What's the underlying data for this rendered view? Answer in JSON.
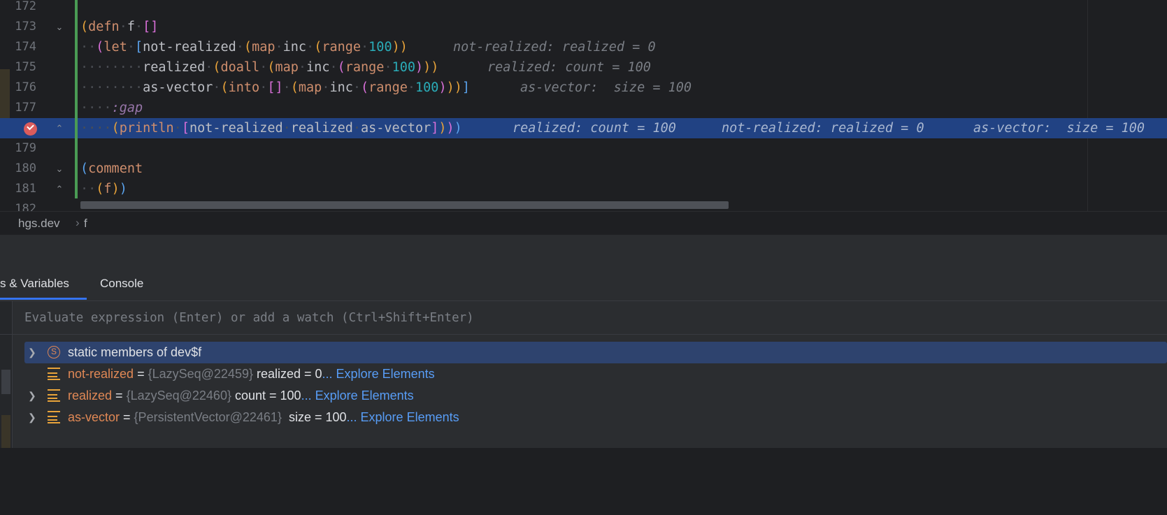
{
  "editor": {
    "lines": [
      {
        "n": "172"
      },
      {
        "n": "173"
      },
      {
        "n": "174",
        "inlay": "not-realized: realized = 0"
      },
      {
        "n": "175",
        "inlay": "realized: count = 100"
      },
      {
        "n": "176",
        "inlay": "as-vector:  size = 100"
      },
      {
        "n": "177"
      },
      {
        "n": "178",
        "inlays": [
          "realized: count = 100",
          "not-realized: realized = 0",
          "as-vector:  size = 100"
        ]
      },
      {
        "n": "179"
      },
      {
        "n": "180"
      },
      {
        "n": "181"
      },
      {
        "n": "182"
      }
    ],
    "code": {
      "l173": [
        "(",
        "defn",
        "f",
        "[",
        "]"
      ],
      "l174": [
        "(",
        "let",
        "[",
        "not-realized",
        "(",
        "map",
        "inc",
        "(",
        "range",
        "100",
        ")",
        ")"
      ],
      "l175": [
        "realized",
        "(",
        "doall",
        "(",
        "map",
        "inc",
        "(",
        "range",
        "100",
        ")",
        ")",
        ")"
      ],
      "l176": [
        "as-vector",
        "(",
        "into",
        "[",
        "]",
        "(",
        "map",
        "inc",
        "(",
        "range",
        "100",
        ")",
        ")",
        ")",
        "]"
      ],
      "l177": [
        ":gap"
      ],
      "l178": [
        "(",
        "println",
        "[",
        "not-realized",
        "realized",
        "as-vector",
        "]",
        ")",
        ")",
        ")"
      ],
      "l180": [
        "(",
        "comment"
      ],
      "l181": [
        "(",
        "f",
        ")",
        ")"
      ]
    }
  },
  "breadcrumb": {
    "namespace": "hgs.dev",
    "separator": "›",
    "function": "f"
  },
  "debug": {
    "tabs": {
      "variables": "s & Variables",
      "console": "Console"
    },
    "evaluate_placeholder": "Evaluate expression (Enter) or add a watch (Ctrl+Shift+Enter)",
    "rows": [
      {
        "label": "static members of dev$f",
        "icon_letter": "S"
      },
      {
        "name": "not-realized",
        "eq": " = ",
        "type": "{LazySeq@22459}",
        "value": " realized = 0",
        "link": "... Explore Elements"
      },
      {
        "name": "realized",
        "eq": " = ",
        "type": "{LazySeq@22460}",
        "value": " count = 100",
        "link": "... Explore Elements"
      },
      {
        "name": "as-vector",
        "eq": " = ",
        "type": "{PersistentVector@22461}",
        "value": "  size = 100",
        "link": "... Explore Elements"
      }
    ]
  },
  "colors": {
    "execution_line": "#214283",
    "selection": "#2e436e",
    "link": "#589df6",
    "breakpoint": "#db5c5c"
  }
}
